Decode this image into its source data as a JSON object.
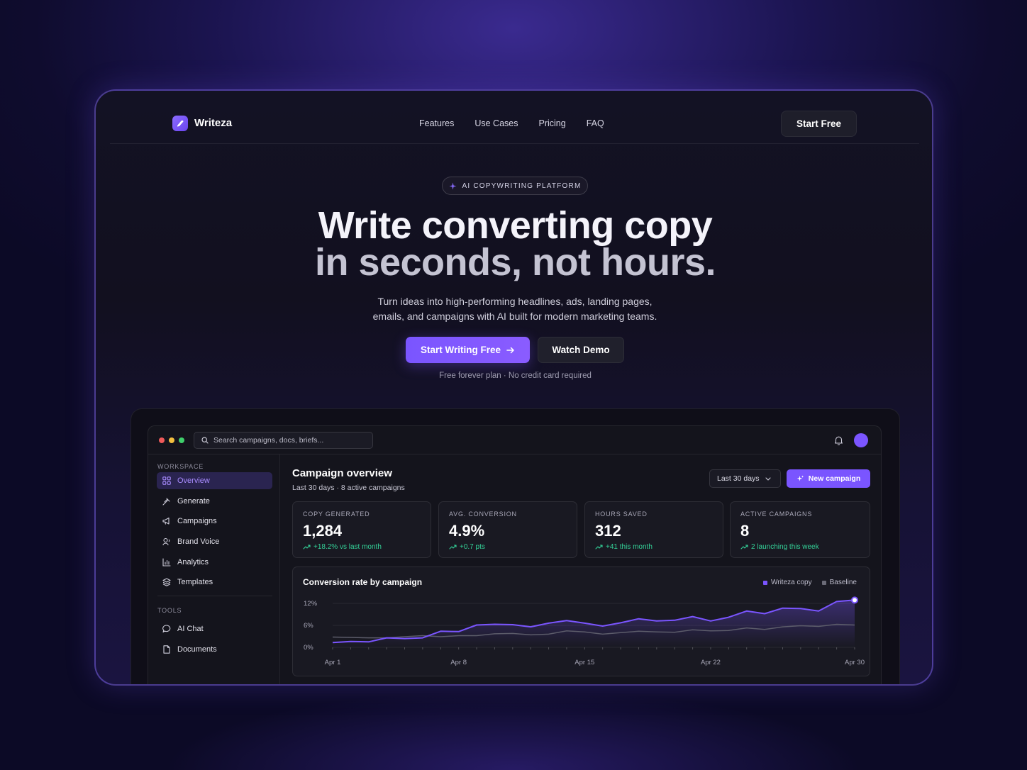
{
  "brand": {
    "name": "Writeza"
  },
  "nav": {
    "links": [
      "Features",
      "Use Cases",
      "Pricing",
      "FAQ"
    ],
    "cta": "Start Free"
  },
  "hero": {
    "badge": "AI COPYWRITING PLATFORM",
    "title_line1": "Write converting copy",
    "title_line2": "in seconds, not hours.",
    "subtitle_line1": "Turn ideas into high-performing headlines, ads, landing pages,",
    "subtitle_line2": "emails, and campaigns with AI built for modern marketing teams.",
    "primary_cta": "Start Writing Free",
    "secondary_cta": "Watch Demo",
    "note": "Free forever plan · No credit card required"
  },
  "app": {
    "search_placeholder": "Search campaigns, docs, briefs...",
    "sidebar": {
      "workspace_heading": "WORKSPACE",
      "workspace_items": [
        {
          "label": "Overview",
          "icon": "grid-icon",
          "active": true
        },
        {
          "label": "Generate",
          "icon": "wand-icon"
        },
        {
          "label": "Campaigns",
          "icon": "megaphone-icon"
        },
        {
          "label": "Brand Voice",
          "icon": "voice-icon"
        },
        {
          "label": "Analytics",
          "icon": "bar-chart-icon"
        },
        {
          "label": "Templates",
          "icon": "layers-icon"
        }
      ],
      "tools_heading": "TOOLS",
      "tools_items": [
        {
          "label": "AI Chat",
          "icon": "chat-icon"
        },
        {
          "label": "Documents",
          "icon": "document-icon"
        }
      ]
    },
    "overview": {
      "title": "Campaign overview",
      "subtitle": "Last 30 days · 8 active campaigns",
      "range": "Last 30 days",
      "new_campaign": "New campaign"
    },
    "stats": [
      {
        "label": "COPY GENERATED",
        "value": "1,284",
        "delta": "+18.2% vs last month"
      },
      {
        "label": "AVG. CONVERSION",
        "value": "4.9%",
        "delta": "+0.7 pts"
      },
      {
        "label": "HOURS SAVED",
        "value": "312",
        "delta": "+41 this month"
      },
      {
        "label": "ACTIVE CAMPAIGNS",
        "value": "8",
        "delta": "2 launching this week"
      }
    ],
    "colors": {
      "accent": "#7a55ff",
      "positive": "#34d399",
      "baseline": "#5c5c6a"
    }
  },
  "chart_data": {
    "type": "line",
    "title": "Conversion rate by campaign",
    "x": [
      "Apr 1",
      "Apr 2",
      "Apr 3",
      "Apr 4",
      "Apr 5",
      "Apr 6",
      "Apr 7",
      "Apr 8",
      "Apr 9",
      "Apr 10",
      "Apr 11",
      "Apr 12",
      "Apr 13",
      "Apr 14",
      "Apr 15",
      "Apr 16",
      "Apr 17",
      "Apr 18",
      "Apr 19",
      "Apr 20",
      "Apr 21",
      "Apr 22",
      "Apr 23",
      "Apr 24",
      "Apr 25",
      "Apr 26",
      "Apr 27",
      "Apr 28",
      "Apr 29",
      "Apr 30"
    ],
    "x_ticks": [
      "Apr 1",
      "Apr 8",
      "Apr 15",
      "Apr 22",
      "Apr 30"
    ],
    "y_ticks": [
      "12%",
      "6%",
      "0%"
    ],
    "ylim": [
      0,
      12
    ],
    "legend_position": "top-right",
    "series": [
      {
        "name": "Writeza copy",
        "color": "#7a55ff",
        "values": [
          1.3,
          1.6,
          1.5,
          2.6,
          2.4,
          2.6,
          4.4,
          4.3,
          6.1,
          6.3,
          6.2,
          5.6,
          6.6,
          7.3,
          6.6,
          5.8,
          6.7,
          7.8,
          7.2,
          7.4,
          8.4,
          7.2,
          8.2,
          9.9,
          9.2,
          10.7,
          10.6,
          9.9,
          12.5,
          12.9
        ]
      },
      {
        "name": "Baseline",
        "color": "#5c5c6a",
        "values": [
          2.8,
          2.7,
          2.6,
          2.6,
          2.9,
          3.2,
          2.9,
          3.2,
          3.2,
          3.7,
          3.8,
          3.4,
          3.6,
          4.5,
          4.2,
          3.6,
          4.0,
          4.4,
          4.2,
          4.1,
          4.8,
          4.5,
          4.6,
          5.3,
          4.9,
          5.6,
          5.9,
          5.7,
          6.3,
          6.1
        ]
      }
    ]
  }
}
